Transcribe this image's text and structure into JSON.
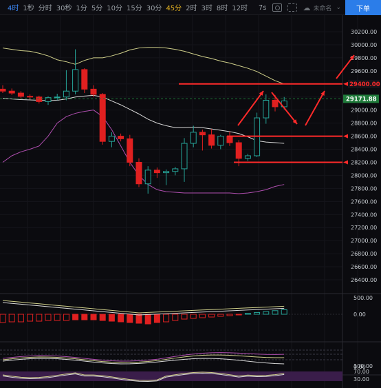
{
  "toolbar": {
    "timeframes": [
      "4时",
      "1秒",
      "分时",
      "30秒",
      "1分",
      "5分",
      "10分",
      "15分",
      "30分",
      "45分",
      "2时",
      "3时",
      "8时",
      "12时"
    ],
    "active_timeframe": "45分",
    "range_label": "7s",
    "layout_name": "未命名",
    "order_button": "下单"
  },
  "colors": {
    "up": "#26a69a",
    "down": "#e02020",
    "accent": "#e6b422",
    "current_price_bg": "#1f7a3a",
    "arrow": "#ff2a2a",
    "mid_band": "#cfcf8a",
    "bands": "#b04fb0"
  },
  "chart_data": {
    "type": "candlestick",
    "price_axis": [
      "30200.00",
      "30000.00",
      "29800.00",
      "29600.00",
      "29400.00",
      "29200.00",
      "29000.00",
      "28800.00",
      "28600.00",
      "28400.00",
      "28200.00",
      "28000.00",
      "27800.00",
      "27600.00",
      "27400.00",
      "27200.00",
      "27000.00",
      "26800.00",
      "26600.00",
      "26400.00"
    ],
    "ylim": [
      26400,
      30200
    ],
    "current_price": "29171.88",
    "level_label": "29400.00",
    "second_level_label": "28600.00",
    "third_level_label": "28200.00",
    "candles": [
      {
        "o": 29320,
        "h": 29380,
        "l": 29260,
        "c": 29290
      },
      {
        "o": 29290,
        "h": 29330,
        "l": 29230,
        "c": 29260
      },
      {
        "o": 29260,
        "h": 29290,
        "l": 29180,
        "c": 29210
      },
      {
        "o": 29210,
        "h": 29240,
        "l": 29160,
        "c": 29200
      },
      {
        "o": 29200,
        "h": 29220,
        "l": 29100,
        "c": 29130
      },
      {
        "o": 29130,
        "h": 29210,
        "l": 29080,
        "c": 29190
      },
      {
        "o": 29190,
        "h": 29250,
        "l": 29150,
        "c": 29200
      },
      {
        "o": 29200,
        "h": 29610,
        "l": 29150,
        "c": 29290
      },
      {
        "o": 29290,
        "h": 29930,
        "l": 29240,
        "c": 29620
      },
      {
        "o": 29620,
        "h": 29640,
        "l": 29260,
        "c": 29320
      },
      {
        "o": 29320,
        "h": 29380,
        "l": 29200,
        "c": 29240
      },
      {
        "o": 29240,
        "h": 29260,
        "l": 28470,
        "c": 28520
      },
      {
        "o": 28520,
        "h": 28660,
        "l": 28430,
        "c": 28600
      },
      {
        "o": 28600,
        "h": 28640,
        "l": 28520,
        "c": 28560
      },
      {
        "o": 28560,
        "h": 28620,
        "l": 28140,
        "c": 28200
      },
      {
        "o": 28200,
        "h": 28260,
        "l": 27820,
        "c": 27870
      },
      {
        "o": 27870,
        "h": 28140,
        "l": 27720,
        "c": 28080
      },
      {
        "o": 28080,
        "h": 28120,
        "l": 27960,
        "c": 28040
      },
      {
        "o": 28040,
        "h": 28090,
        "l": 27850,
        "c": 28060
      },
      {
        "o": 28060,
        "h": 28130,
        "l": 28000,
        "c": 28100
      },
      {
        "o": 28100,
        "h": 28570,
        "l": 27900,
        "c": 28490
      },
      {
        "o": 28490,
        "h": 28760,
        "l": 28430,
        "c": 28660
      },
      {
        "o": 28660,
        "h": 28700,
        "l": 28380,
        "c": 28620
      },
      {
        "o": 28620,
        "h": 28710,
        "l": 28410,
        "c": 28460
      },
      {
        "o": 28460,
        "h": 28620,
        "l": 28400,
        "c": 28600
      },
      {
        "o": 28600,
        "h": 28670,
        "l": 28450,
        "c": 28500
      },
      {
        "o": 28500,
        "h": 28540,
        "l": 28140,
        "c": 28260
      },
      {
        "o": 28260,
        "h": 28330,
        "l": 28220,
        "c": 28300
      },
      {
        "o": 28300,
        "h": 28960,
        "l": 28280,
        "c": 28880
      },
      {
        "o": 28880,
        "h": 29240,
        "l": 28790,
        "c": 29150
      },
      {
        "o": 29150,
        "h": 29230,
        "l": 28980,
        "c": 29050
      },
      {
        "o": 29050,
        "h": 29200,
        "l": 29010,
        "c": 29140
      }
    ],
    "bollinger": {
      "upper": [
        29950,
        29930,
        29910,
        29900,
        29870,
        29830,
        29770,
        29740,
        29700,
        29760,
        29800,
        29800,
        29830,
        29870,
        29920,
        29950,
        29960,
        29960,
        29950,
        29930,
        29900,
        29860,
        29820,
        29790,
        29750,
        29720,
        29680,
        29640,
        29590,
        29520,
        29450,
        29400
      ],
      "mid": [
        29180,
        29170,
        29160,
        29155,
        29150,
        29145,
        29150,
        29170,
        29200,
        29215,
        29225,
        29200,
        29140,
        29080,
        29010,
        28940,
        28860,
        28800,
        28760,
        28730,
        28730,
        28740,
        28730,
        28710,
        28690,
        28670,
        28640,
        28590,
        28530,
        28510,
        28500,
        28490
      ],
      "lower": [
        28200,
        28300,
        28360,
        28400,
        28450,
        28600,
        28800,
        28900,
        28950,
        28980,
        29000,
        28900,
        28700,
        28450,
        28200,
        28000,
        27860,
        27780,
        27750,
        27740,
        27730,
        27730,
        27730,
        27730,
        27730,
        27730,
        27720,
        27730,
        27750,
        27780,
        27830,
        27860
      ]
    },
    "subpanels": {
      "macd_axis": [
        "500.00",
        "0.00"
      ],
      "osc_axis": [
        "0.00"
      ],
      "rsi_axis": [
        "100.00",
        "70.00",
        "30.00"
      ]
    }
  }
}
